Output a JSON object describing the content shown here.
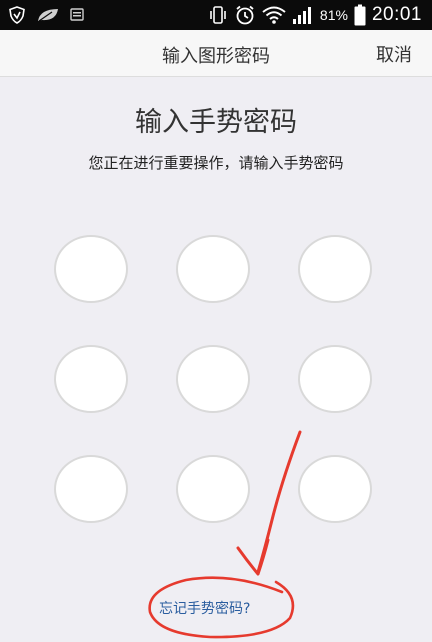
{
  "status_bar": {
    "battery_percent": "81%",
    "time": "20:01",
    "icons": [
      "shield-notification-icon",
      "leaf-notification-icon",
      "keyboard-notification-icon",
      "vibrate-icon",
      "alarm-icon",
      "wifi-icon",
      "signal-icon",
      "battery-icon"
    ]
  },
  "header": {
    "title": "输入图形密码",
    "cancel_label": "取消"
  },
  "main": {
    "title": "输入手势密码",
    "subtitle": "您正在进行重要操作，请输入手势密码"
  },
  "gesture": {
    "points": [
      1,
      2,
      3,
      4,
      5,
      6,
      7,
      8,
      9
    ]
  },
  "footer": {
    "forgot_label": "忘记手势密码?"
  },
  "colors": {
    "status_bar_bg": "#0b0b0b",
    "header_bg": "#f7f7f7",
    "page_bg": "#efeef3",
    "dot_border": "#d9d9d9",
    "link": "#2a5d9f",
    "annotation": "#e63a2e"
  }
}
